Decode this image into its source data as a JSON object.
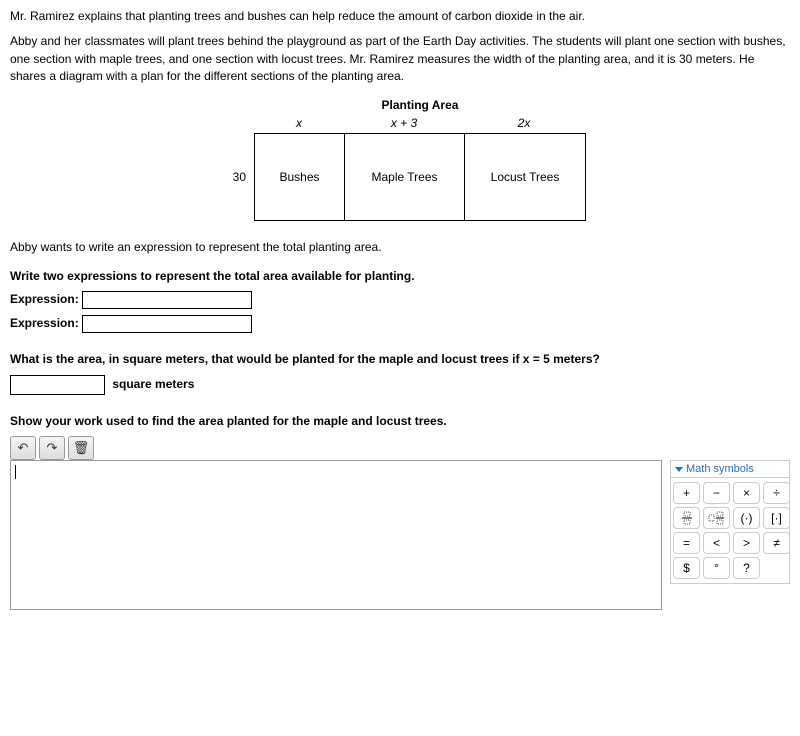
{
  "intro": {
    "p1": "Mr. Ramirez explains that planting trees and bushes can help reduce the amount of carbon dioxide in the air.",
    "p2": "Abby and her classmates will plant trees behind the playground as part of the Earth Day activities. The students will plant one section with bushes, one section with maple trees, and one section with locust trees. Mr. Ramirez measures the width of the planting area, and it is 30 meters. He shares a diagram with a plan for the different sections of the planting area."
  },
  "diagram": {
    "title": "Planting Area",
    "col_labels": {
      "c1": "x",
      "c2": "x + 3",
      "c3": "2x"
    },
    "row_label": "30",
    "cells": {
      "c1": "Bushes",
      "c2": "Maple Trees",
      "c3": "Locust Trees"
    }
  },
  "q1_intro": "Abby wants to write an expression to represent the total planting area.",
  "q1_prompt": "Write two expressions to represent the total area available for planting.",
  "expr_label": "Expression:",
  "q2_prompt": "What is the area, in square meters, that would be planted for the maple and locust trees if x = 5 meters?",
  "q2_unit": "square meters",
  "q3_prompt": "Show your work used to find the area planted for the maple and locust trees.",
  "palette": {
    "header": "Math symbols",
    "symbols": [
      "+",
      "−",
      "×",
      "÷",
      "frac",
      "mixed",
      "(·)",
      "[·]",
      "=",
      "<",
      ">",
      "≠",
      "$",
      "°",
      "?"
    ]
  },
  "toolbar": {
    "undo": "↶",
    "redo": "↷",
    "trash": "🗑"
  }
}
